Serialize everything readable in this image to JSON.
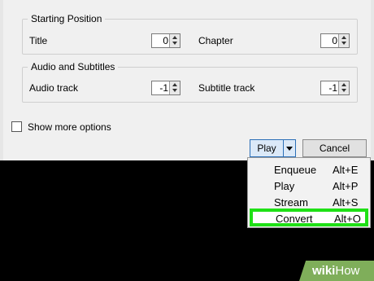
{
  "groups": {
    "starting_position": {
      "title": "Starting Position",
      "title_label": "Title",
      "title_value": "0",
      "chapter_label": "Chapter",
      "chapter_value": "0"
    },
    "audio_subtitles": {
      "title": "Audio and Subtitles",
      "audio_label": "Audio track",
      "audio_value": "-1",
      "subtitle_label": "Subtitle track",
      "subtitle_value": "-1"
    }
  },
  "show_more_options": {
    "label": "Show more options",
    "checked": false
  },
  "buttons": {
    "play": "Play",
    "cancel": "Cancel"
  },
  "play_menu": [
    {
      "label": "Enqueue",
      "shortcut": "Alt+E"
    },
    {
      "label": "Play",
      "shortcut": "Alt+P"
    },
    {
      "label": "Stream",
      "shortcut": "Alt+S"
    },
    {
      "label": "Convert",
      "shortcut": "Alt+O",
      "highlighted": true
    }
  ],
  "watermark": {
    "wiki": "wiki",
    "how": "How"
  },
  "colors": {
    "dialog_bg": "#f0f0f0",
    "highlight_border": "#1fe016",
    "play_button_border": "#2b6fb7",
    "watermark_green": "#7fae5a"
  }
}
